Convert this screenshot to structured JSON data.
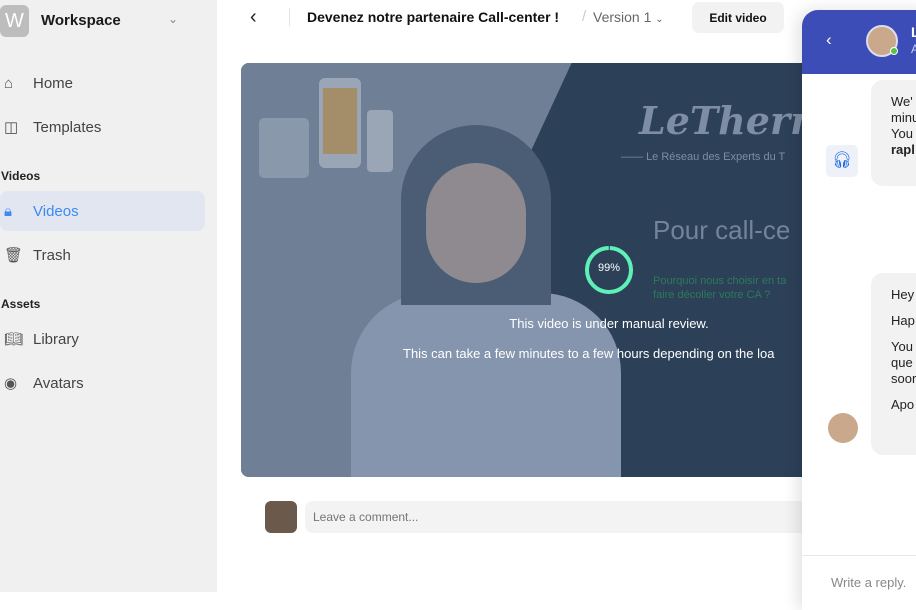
{
  "sidebar": {
    "workspace_initial": "W",
    "workspace_name": "Workspace",
    "items": [
      {
        "label": "Home",
        "icon": "home-icon"
      },
      {
        "label": "Templates",
        "icon": "layout-icon"
      },
      {
        "label": "Videos",
        "icon": "lock-icon",
        "active": true
      },
      {
        "label": "Trash",
        "icon": "trash-icon"
      },
      {
        "label": "Library",
        "icon": "book-icon"
      },
      {
        "label": "Avatars",
        "icon": "user-circle-icon"
      }
    ],
    "sections": [
      "Videos",
      "Assets"
    ]
  },
  "header": {
    "title": "Devenez notre partenaire Call-center !",
    "separator": "/",
    "version": "Version 1",
    "edit_label": "Edit video"
  },
  "video": {
    "logo": "LeThermostat",
    "tagline": "Le Réseau des Experts du T",
    "headline": "Pour call-ce",
    "question": "Pourquoi nous choisir en ta",
    "question2": "faire décoller votre CA ?",
    "progress_percent": 99,
    "progress_label": "99%",
    "review_text": "This video is under manual review.",
    "review_detail": "This can take a few minutes to a few hours depending on the loa",
    "ring_color": "#5ff0b8"
  },
  "comment": {
    "placeholder": "Leave a comment..."
  },
  "chat": {
    "name": "L",
    "subtitle": "A",
    "header_color": "#3c4db7",
    "message1": [
      "We'",
      "minu",
      "You",
      "rapl"
    ],
    "message2": [
      "Hey",
      "Hap",
      "You",
      "que",
      "soor",
      "Apo"
    ],
    "reply_placeholder": "Write a reply."
  }
}
